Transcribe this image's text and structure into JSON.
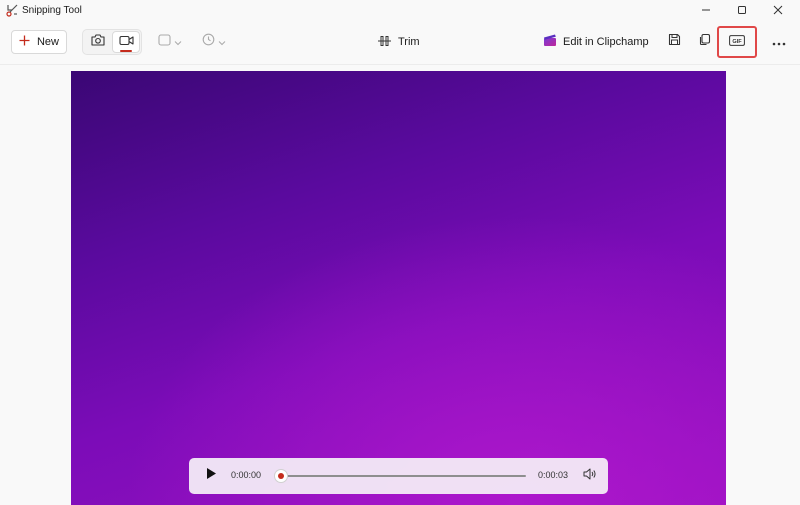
{
  "window": {
    "title": "Snipping Tool"
  },
  "toolbar": {
    "new_label": "New",
    "trim_label": "Trim",
    "clipchamp_label": "Edit in Clipchamp",
    "gif_label": "GIF",
    "highlight_color": "#e04848"
  },
  "player": {
    "current_time": "0:00:00",
    "end_time": "0:00:03",
    "progress": 0
  },
  "colors": {
    "accent": "#c42b1c",
    "video_top": "#3a0774",
    "video_bottom": "#a815c8"
  },
  "icons": {
    "app": "snipping-tool-icon",
    "minimize": "minimize-icon",
    "maximize": "maximize-icon",
    "close": "close-icon",
    "new": "plus-icon",
    "photo_mode": "camera-icon",
    "video_mode": "video-camera-icon",
    "shape": "rectangle-icon",
    "timer": "clock-icon",
    "trim": "trim-icon",
    "clipchamp": "clipchamp-icon",
    "save": "save-icon",
    "copy": "copy-icon",
    "gif": "gif-icon",
    "more": "more-icon",
    "play": "play-icon",
    "volume": "volume-icon"
  }
}
